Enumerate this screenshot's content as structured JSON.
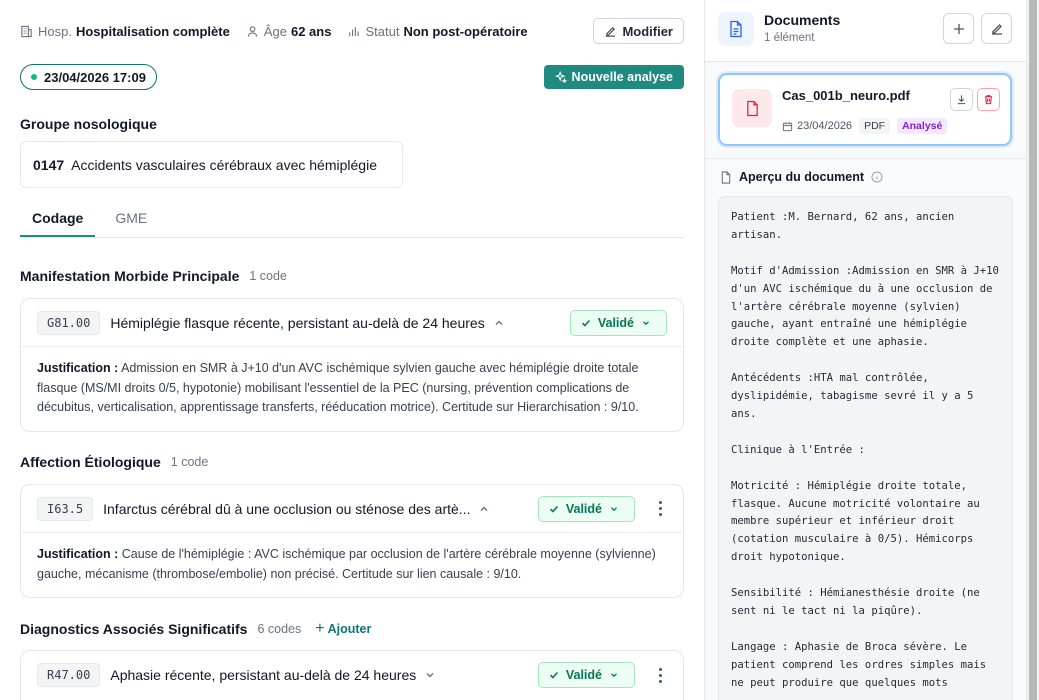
{
  "header": {
    "hosp_label": "Hosp.",
    "hosp_value": "Hospitalisation complète",
    "age_label": "Âge",
    "age_value": "62 ans",
    "statut_label": "Statut",
    "statut_value": "Non post-opératoire",
    "modifier_label": "Modifier"
  },
  "analysis": {
    "date": "23/04/2026 17:09",
    "new_analysis_label": "Nouvelle analyse"
  },
  "groupe": {
    "title": "Groupe nosologique",
    "code": "0147",
    "label": "Accidents vasculaires cérébraux avec hémiplégie"
  },
  "tabs": [
    {
      "label": "Codage",
      "active": true
    },
    {
      "label": "GME",
      "active": false
    }
  ],
  "sections": {
    "mmp": {
      "title": "Manifestation Morbide Principale",
      "count": "1 code",
      "item": {
        "code": "G81.00",
        "label": "Hémiplégie flasque récente, persistant au-delà de 24 heures",
        "status": "Validé",
        "justification_label": "Justification :",
        "justification": "Admission en SMR à J+10 d'un AVC ischémique sylvien gauche avec hémiplégie droite totale flasque (MS/MI droits 0/5, hypotonie) mobilisant l'essentiel de la PEC (nursing, prévention complications de décubitus, verticalisation, apprentissage transferts, rééducation motrice). Certitude sur Hierarchisation : 9/10."
      }
    },
    "ae": {
      "title": "Affection Étiologique",
      "count": "1 code",
      "item": {
        "code": "I63.5",
        "label": "Infarctus cérébral dû à une occlusion ou sténose des artè...",
        "status": "Validé",
        "justification_label": "Justification :",
        "justification": "Cause de l'hémiplégie : AVC ischémique par occlusion de l'artère cérébrale moyenne (sylvienne) gauche, mécanisme (thrombose/embolie) non précisé. Certitude sur lien causale : 9/10."
      }
    },
    "das": {
      "title": "Diagnostics Associés Significatifs",
      "count": "6 codes",
      "add_label": "Ajouter",
      "item": {
        "code": "R47.00",
        "label": "Aphasie récente, persistant au-delà de 24 heures",
        "status": "Validé"
      }
    }
  },
  "documents": {
    "title": "Documents",
    "count": "1 élément",
    "file": {
      "name": "Cas_001b_neuro.pdf",
      "date": "23/04/2026",
      "type": "PDF",
      "status": "Analysé"
    },
    "preview_title": "Aperçu du document",
    "preview_text": "Patient :M. Bernard, 62 ans, ancien artisan.\n\nMotif d'Admission :Admission en SMR à J+10 d'un AVC ischémique du à une occlusion de l'artère cérébrale moyenne (sylvien) gauche, ayant entraîné une hémiplégie droite complète et une aphasie.\n\nAntécédents :HTA mal contrôlée, dyslipidémie, tabagisme sevré il y a 5 ans.\n\nClinique à l'Entrée :\n\nMotricité : Hémiplégie droite totale, flasque. Aucune motricité volontaire au membre supérieur et inférieur droit (cotation musculaire à 0/5). Hémicorps droit hypotonique.\n\nSensibilité : Hémianesthésie droite (ne sent ni le tact ni la piqûre).\n\nLangage : Aphasie de Broca sévère. Le patient comprend les ordres simples mais ne peut produire que quelques mots"
  },
  "colors": {
    "accent": "#1f8a80",
    "validated_bg": "#ecfdf3",
    "validated_text": "#047857",
    "analysed_tag": "#7e22ce"
  }
}
